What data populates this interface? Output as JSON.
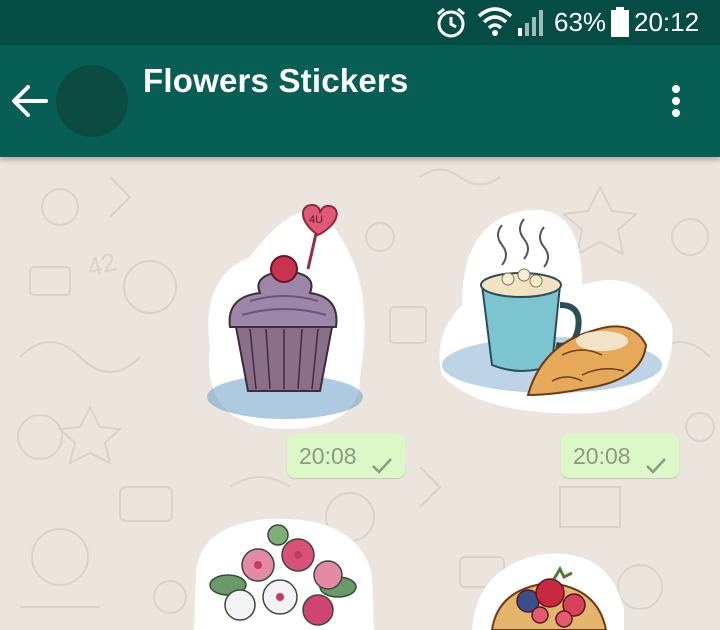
{
  "status_bar": {
    "battery_percent": "63%",
    "time": "20:12",
    "icons": [
      "alarm-icon",
      "wifi-icon",
      "signal-icon",
      "battery-icon"
    ]
  },
  "header": {
    "title": "Flowers Stickers",
    "back_icon": "arrow-back-icon",
    "menu_icon": "more-vert-icon"
  },
  "messages": [
    {
      "sticker": "cupcake-sticker",
      "time": "20:08",
      "status": "sent-check-icon"
    },
    {
      "sticker": "cocoa-croissant-sticker",
      "time": "20:08",
      "status": "sent-check-icon"
    },
    {
      "sticker": "flower-bouquet-sticker"
    },
    {
      "sticker": "berry-tart-sticker"
    }
  ],
  "colors": {
    "status_bar": "#054d44",
    "app_bar": "#075e54",
    "chat_background": "#ece5dd",
    "outgoing_bubble": "#dcf8c6",
    "timestamp": "#8a9a83"
  }
}
